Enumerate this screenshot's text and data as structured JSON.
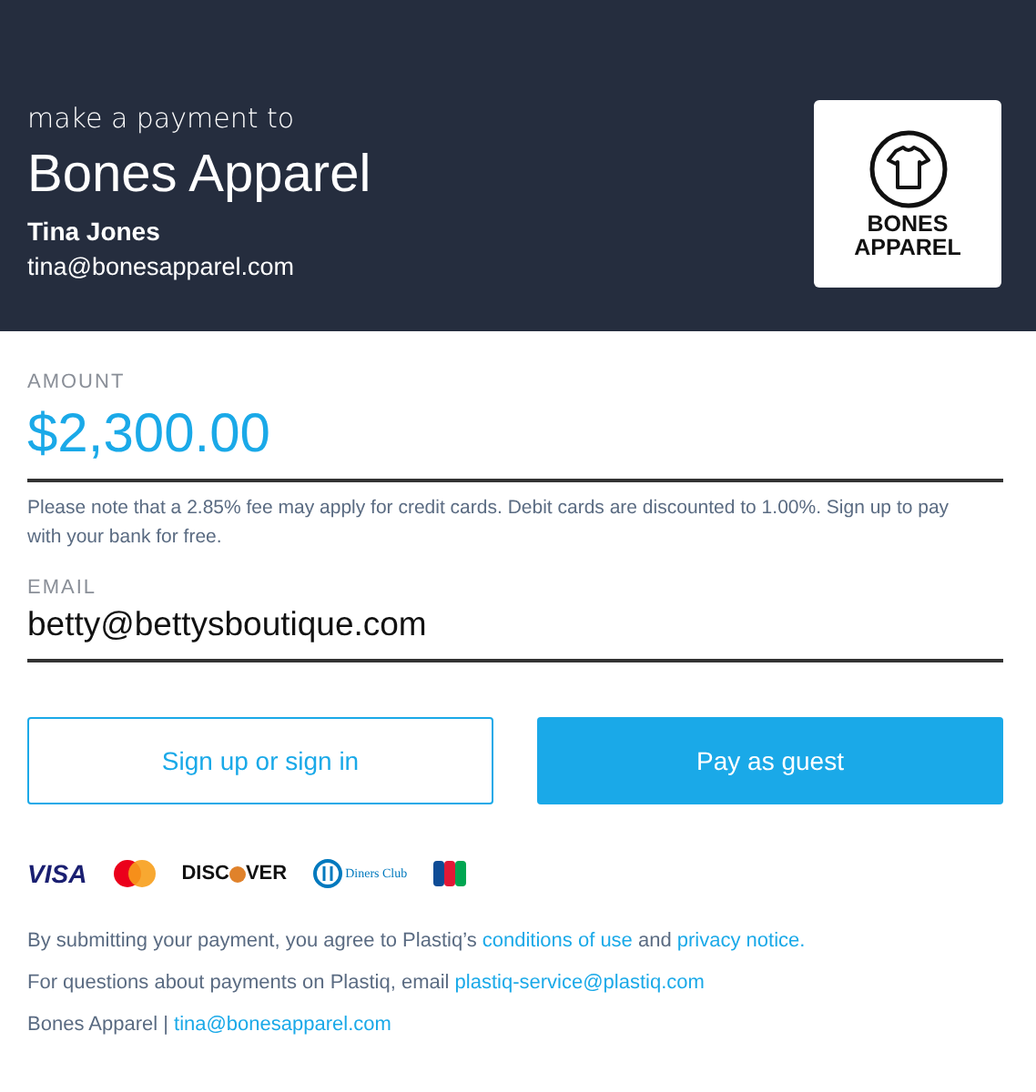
{
  "header": {
    "intro": "make a payment to",
    "merchant": "Bones Apparel",
    "contact_name": "Tina Jones",
    "contact_email": "tina@bonesapparel.com",
    "logo": {
      "line_1": "BONES",
      "line_2": "APPAREL"
    }
  },
  "amount": {
    "label": "AMOUNT",
    "value": "$2,300.00",
    "note": "Please note that a 2.85% fee may apply for credit cards. Debit cards are discounted to 1.00%. Sign up to pay with your bank for free."
  },
  "email": {
    "label": "EMAIL",
    "value": "betty@bettysboutique.com"
  },
  "buttons": [
    {
      "kind": "outline",
      "label": "Sign up or sign in"
    },
    {
      "kind": "filled",
      "label": "Pay as guest"
    }
  ],
  "cards": [
    {
      "kind": "visa",
      "text": "VISA"
    },
    {
      "kind": "mastercard"
    },
    {
      "kind": "discover",
      "text": "DISC",
      "text_2": "VER"
    },
    {
      "kind": "diners",
      "text": "Diners Club"
    },
    {
      "kind": "jcb"
    }
  ],
  "footer": [
    [
      {
        "text": "By submitting your payment, you agree to Plastiq’s ",
        "link": false
      },
      {
        "text": "conditions of use",
        "link": true
      },
      {
        "text": " and ",
        "link": false
      },
      {
        "text": "privacy notice.",
        "link": true
      }
    ],
    [
      {
        "text": "For questions about payments on Plastiq, email ",
        "link": false
      },
      {
        "text": "plastiq-service@plastiq.com",
        "link": true
      }
    ],
    [
      {
        "text": "Bones Apparel | ",
        "link": false
      },
      {
        "text": "tina@bonesapparel.com",
        "link": true
      }
    ]
  ]
}
